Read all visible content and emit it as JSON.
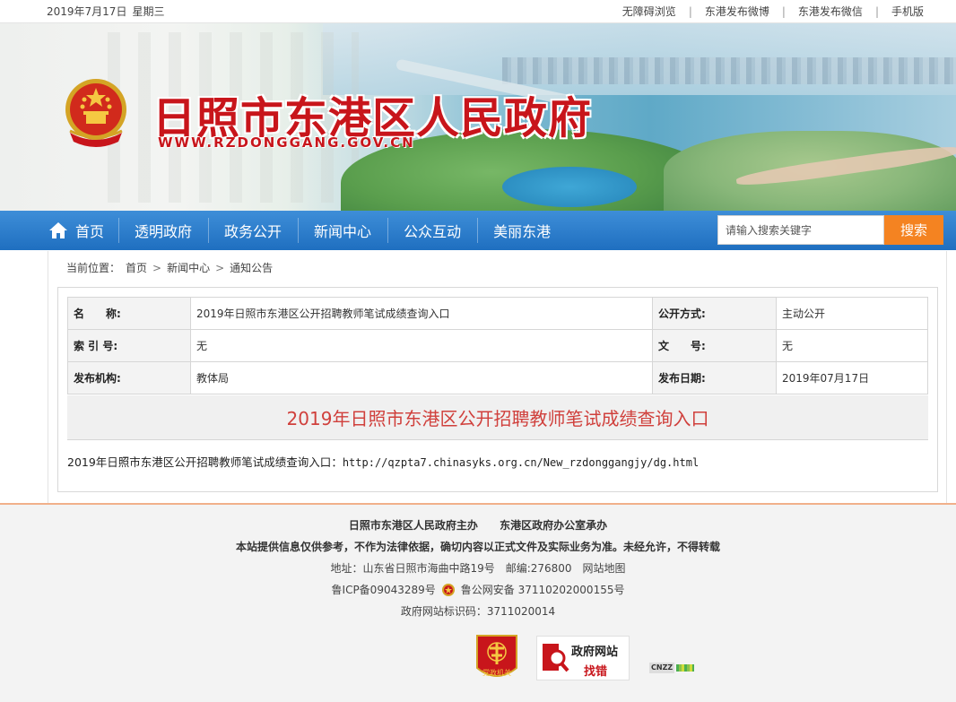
{
  "topbar": {
    "date": "2019年7月17日",
    "weekday": "星期三",
    "links": [
      "无障碍浏览",
      "东港发布微博",
      "东港发布微信",
      "手机版"
    ]
  },
  "header": {
    "title": "日照市东港区人民政府",
    "url": "WWW.RZDONGGANG.GOV.CN"
  },
  "nav": {
    "items": [
      "首页",
      "透明政府",
      "政务公开",
      "新闻中心",
      "公众互动",
      "美丽东港"
    ],
    "search_placeholder": "请输入搜索关键字",
    "search_button": "搜索"
  },
  "breadcrumb": {
    "label": "当前位置：",
    "items": [
      "首页",
      "新闻中心",
      "通知公告"
    ]
  },
  "meta": {
    "name_key": "名　　称:",
    "name_val": "2019年日照市东港区公开招聘教师笔试成绩查询入口",
    "mode_key": "公开方式:",
    "mode_val": "主动公开",
    "index_key": "索 引 号:",
    "index_val": "无",
    "doc_key": "文　　号:",
    "doc_val": "无",
    "org_key": "发布机构:",
    "org_val": "教体局",
    "date_key": "发布日期:",
    "date_val": "2019年07月17日"
  },
  "article": {
    "title": "2019年日照市东港区公开招聘教师笔试成绩查询入口",
    "body_prefix": "2019年日照市东港区公开招聘教师笔试成绩查询入口：",
    "body_url": "http://qzpta7.chinasyks.org.cn/New_rzdonggangjy/dg.html"
  },
  "footer": {
    "host": "日照市东港区人民政府主办",
    "organizer": "东港区政府办公室承办",
    "disclaimer": "本站提供信息仅供参考，不作为法律依据，确切内容以正式文件及实际业务为准。未经允许，不得转载",
    "address": "地址：山东省日照市海曲中路19号　邮编:276800　网站地图",
    "icp": "鲁ICP备09043289号",
    "police": "鲁公网安备 37110202000155号",
    "site_id": "政府网站标识码：3711020014",
    "badge_party": "党政机关",
    "badge_report_1": "政府网站",
    "badge_report_2": "找错",
    "cnzz": "CNZZ"
  },
  "colors": {
    "nav_blue": "#2a7bcc",
    "title_red": "#c8151b",
    "search_orange": "#f48321",
    "article_title_red": "#d0403c"
  }
}
